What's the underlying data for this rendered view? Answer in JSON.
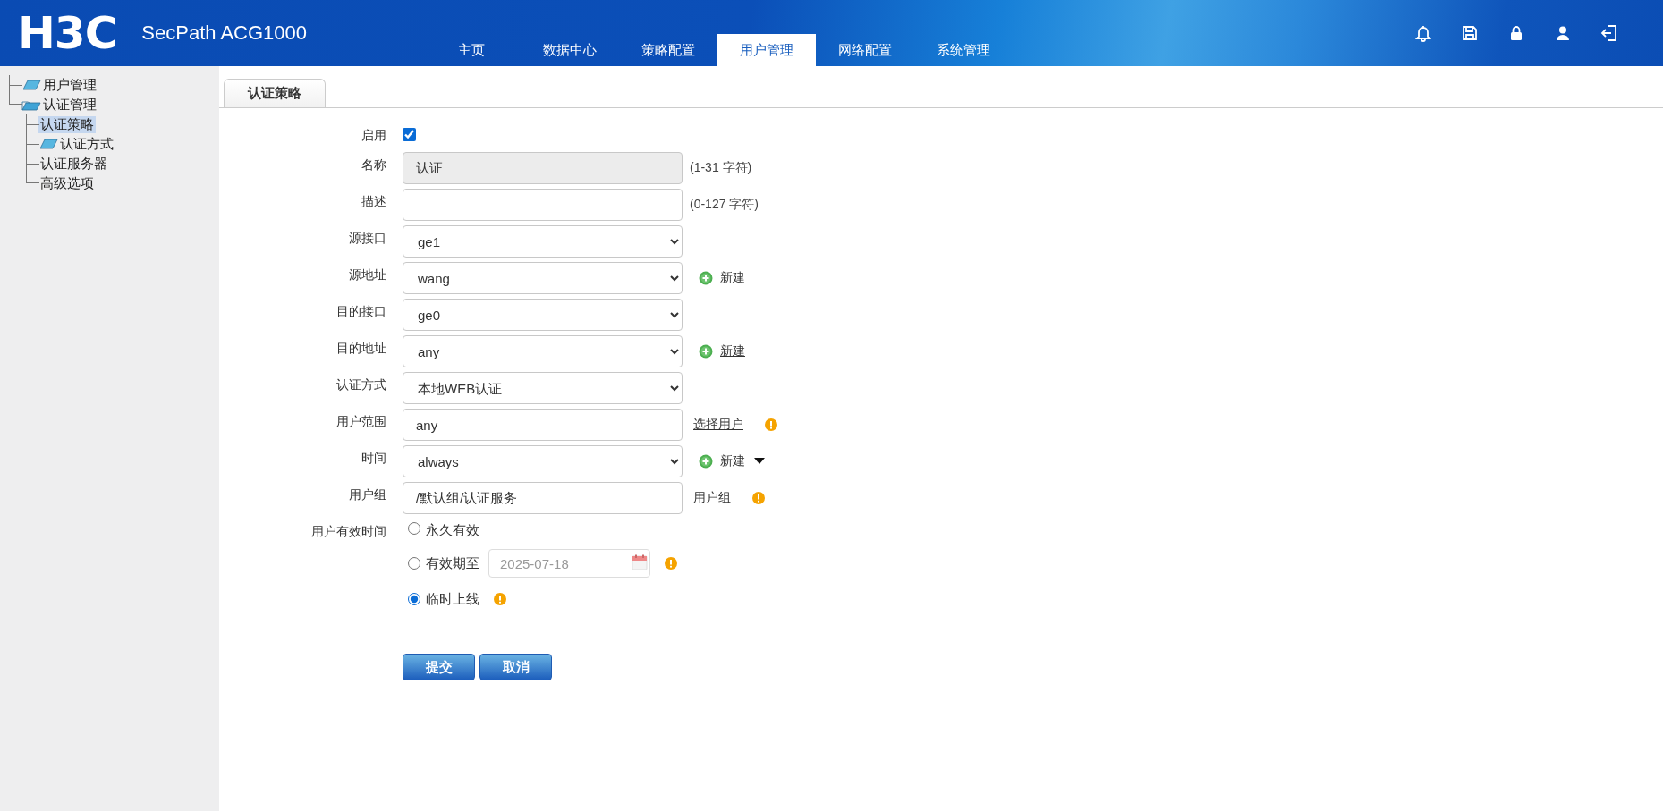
{
  "header": {
    "logo": "H3C",
    "product": "SecPath ACG1000",
    "nav": [
      {
        "label": "主页",
        "selected": false
      },
      {
        "label": "数据中心",
        "selected": false
      },
      {
        "label": "策略配置",
        "selected": false
      },
      {
        "label": "用户管理",
        "selected": true
      },
      {
        "label": "网络配置",
        "selected": false
      },
      {
        "label": "系统管理",
        "selected": false
      }
    ]
  },
  "sidebar": {
    "items": [
      {
        "label": "用户管理",
        "kind": "folder",
        "expanded": false,
        "selected": false
      },
      {
        "label": "认证管理",
        "kind": "folder",
        "expanded": true,
        "selected": false,
        "children": [
          {
            "label": "认证策略",
            "kind": "leaf",
            "selected": true
          },
          {
            "label": "认证方式",
            "kind": "folder",
            "expanded": false,
            "selected": false
          },
          {
            "label": "认证服务器",
            "kind": "leaf",
            "selected": false
          },
          {
            "label": "高级选项",
            "kind": "leaf",
            "selected": false
          }
        ]
      }
    ]
  },
  "tabs": [
    {
      "label": "认证策略",
      "selected": true
    }
  ],
  "form": {
    "rows": [
      {
        "label": "启用",
        "kind": "checkbox",
        "checked": true
      },
      {
        "label": "名称",
        "kind": "text",
        "value": "认证",
        "disabled": true,
        "hint": "(1-31 字符)"
      },
      {
        "label": "描述",
        "kind": "text",
        "disabled": false,
        "hint": "(0-127 字符)"
      },
      {
        "label": "源接口",
        "kind": "select",
        "value": "ge1"
      },
      {
        "label": "源地址",
        "kind": "select",
        "value": "wang",
        "action": {
          "kind": "add-link",
          "label": "新建"
        }
      },
      {
        "label": "目的接口",
        "kind": "select",
        "value": "ge0"
      },
      {
        "label": "目的地址",
        "kind": "select",
        "value": "any",
        "action": {
          "kind": "add-link",
          "label": "新建"
        }
      },
      {
        "label": "认证方式",
        "kind": "select",
        "value": "本地WEB认证"
      },
      {
        "label": "用户范围",
        "kind": "text",
        "value": "any",
        "disabled": false,
        "action": {
          "kind": "link",
          "label": "选择用户"
        },
        "warning": true
      },
      {
        "label": "时间",
        "kind": "select",
        "value": "always",
        "action": {
          "kind": "add-menu",
          "label": "新建"
        }
      },
      {
        "label": "用户组",
        "kind": "text",
        "value": "/默认组/认证服务",
        "disabled": false,
        "action": {
          "kind": "link",
          "label": "用户组"
        },
        "warning": true
      }
    ],
    "validity": {
      "label": "用户有效时间",
      "options": [
        {
          "label": "永久有效",
          "selected": false
        },
        {
          "label": "有效期至",
          "selected": false,
          "date": "2025-07-18",
          "warning": true
        },
        {
          "label": "临时上线",
          "selected": true,
          "warning": true
        }
      ]
    },
    "buttons": [
      "提交",
      "取消"
    ]
  }
}
